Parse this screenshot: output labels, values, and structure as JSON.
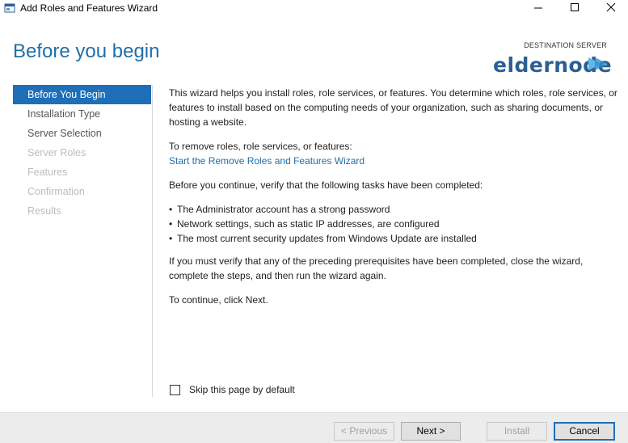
{
  "window": {
    "title": "Add Roles and Features Wizard"
  },
  "header": {
    "page_title": "Before you begin",
    "destination_label": "DESTINATION SERVER",
    "logo_text": "eldernode"
  },
  "nav": {
    "items": [
      {
        "label": "Before You Begin",
        "state": "active"
      },
      {
        "label": "Installation Type",
        "state": "enabled"
      },
      {
        "label": "Server Selection",
        "state": "enabled"
      },
      {
        "label": "Server Roles",
        "state": "disabled"
      },
      {
        "label": "Features",
        "state": "disabled"
      },
      {
        "label": "Confirmation",
        "state": "disabled"
      },
      {
        "label": "Results",
        "state": "disabled"
      }
    ]
  },
  "content": {
    "intro": "This wizard helps you install roles, role services, or features. You determine which roles, role services, or features to install based on the computing needs of your organization, such as sharing documents, or hosting a website.",
    "remove_heading": "To remove roles, role services, or features:",
    "remove_link": "Start the Remove Roles and Features Wizard",
    "verify_heading": "Before you continue, verify that the following tasks have been completed:",
    "bullets": [
      "The Administrator account has a strong password",
      "Network settings, such as static IP addresses, are configured",
      "The most current security updates from Windows Update are installed"
    ],
    "prereq_note": "If you must verify that any of the preceding prerequisites have been completed, close the wizard, complete the steps, and then run the wizard again.",
    "continue_note": "To continue, click Next."
  },
  "skip": {
    "label": "Skip this page by default",
    "checked": false
  },
  "footer": {
    "previous_label": "< Previous",
    "next_label": "Next >",
    "install_label": "Install",
    "cancel_label": "Cancel"
  },
  "colors": {
    "accent": "#1e6fb8",
    "title": "#1f6fa8",
    "logo": "#2c5f91"
  }
}
